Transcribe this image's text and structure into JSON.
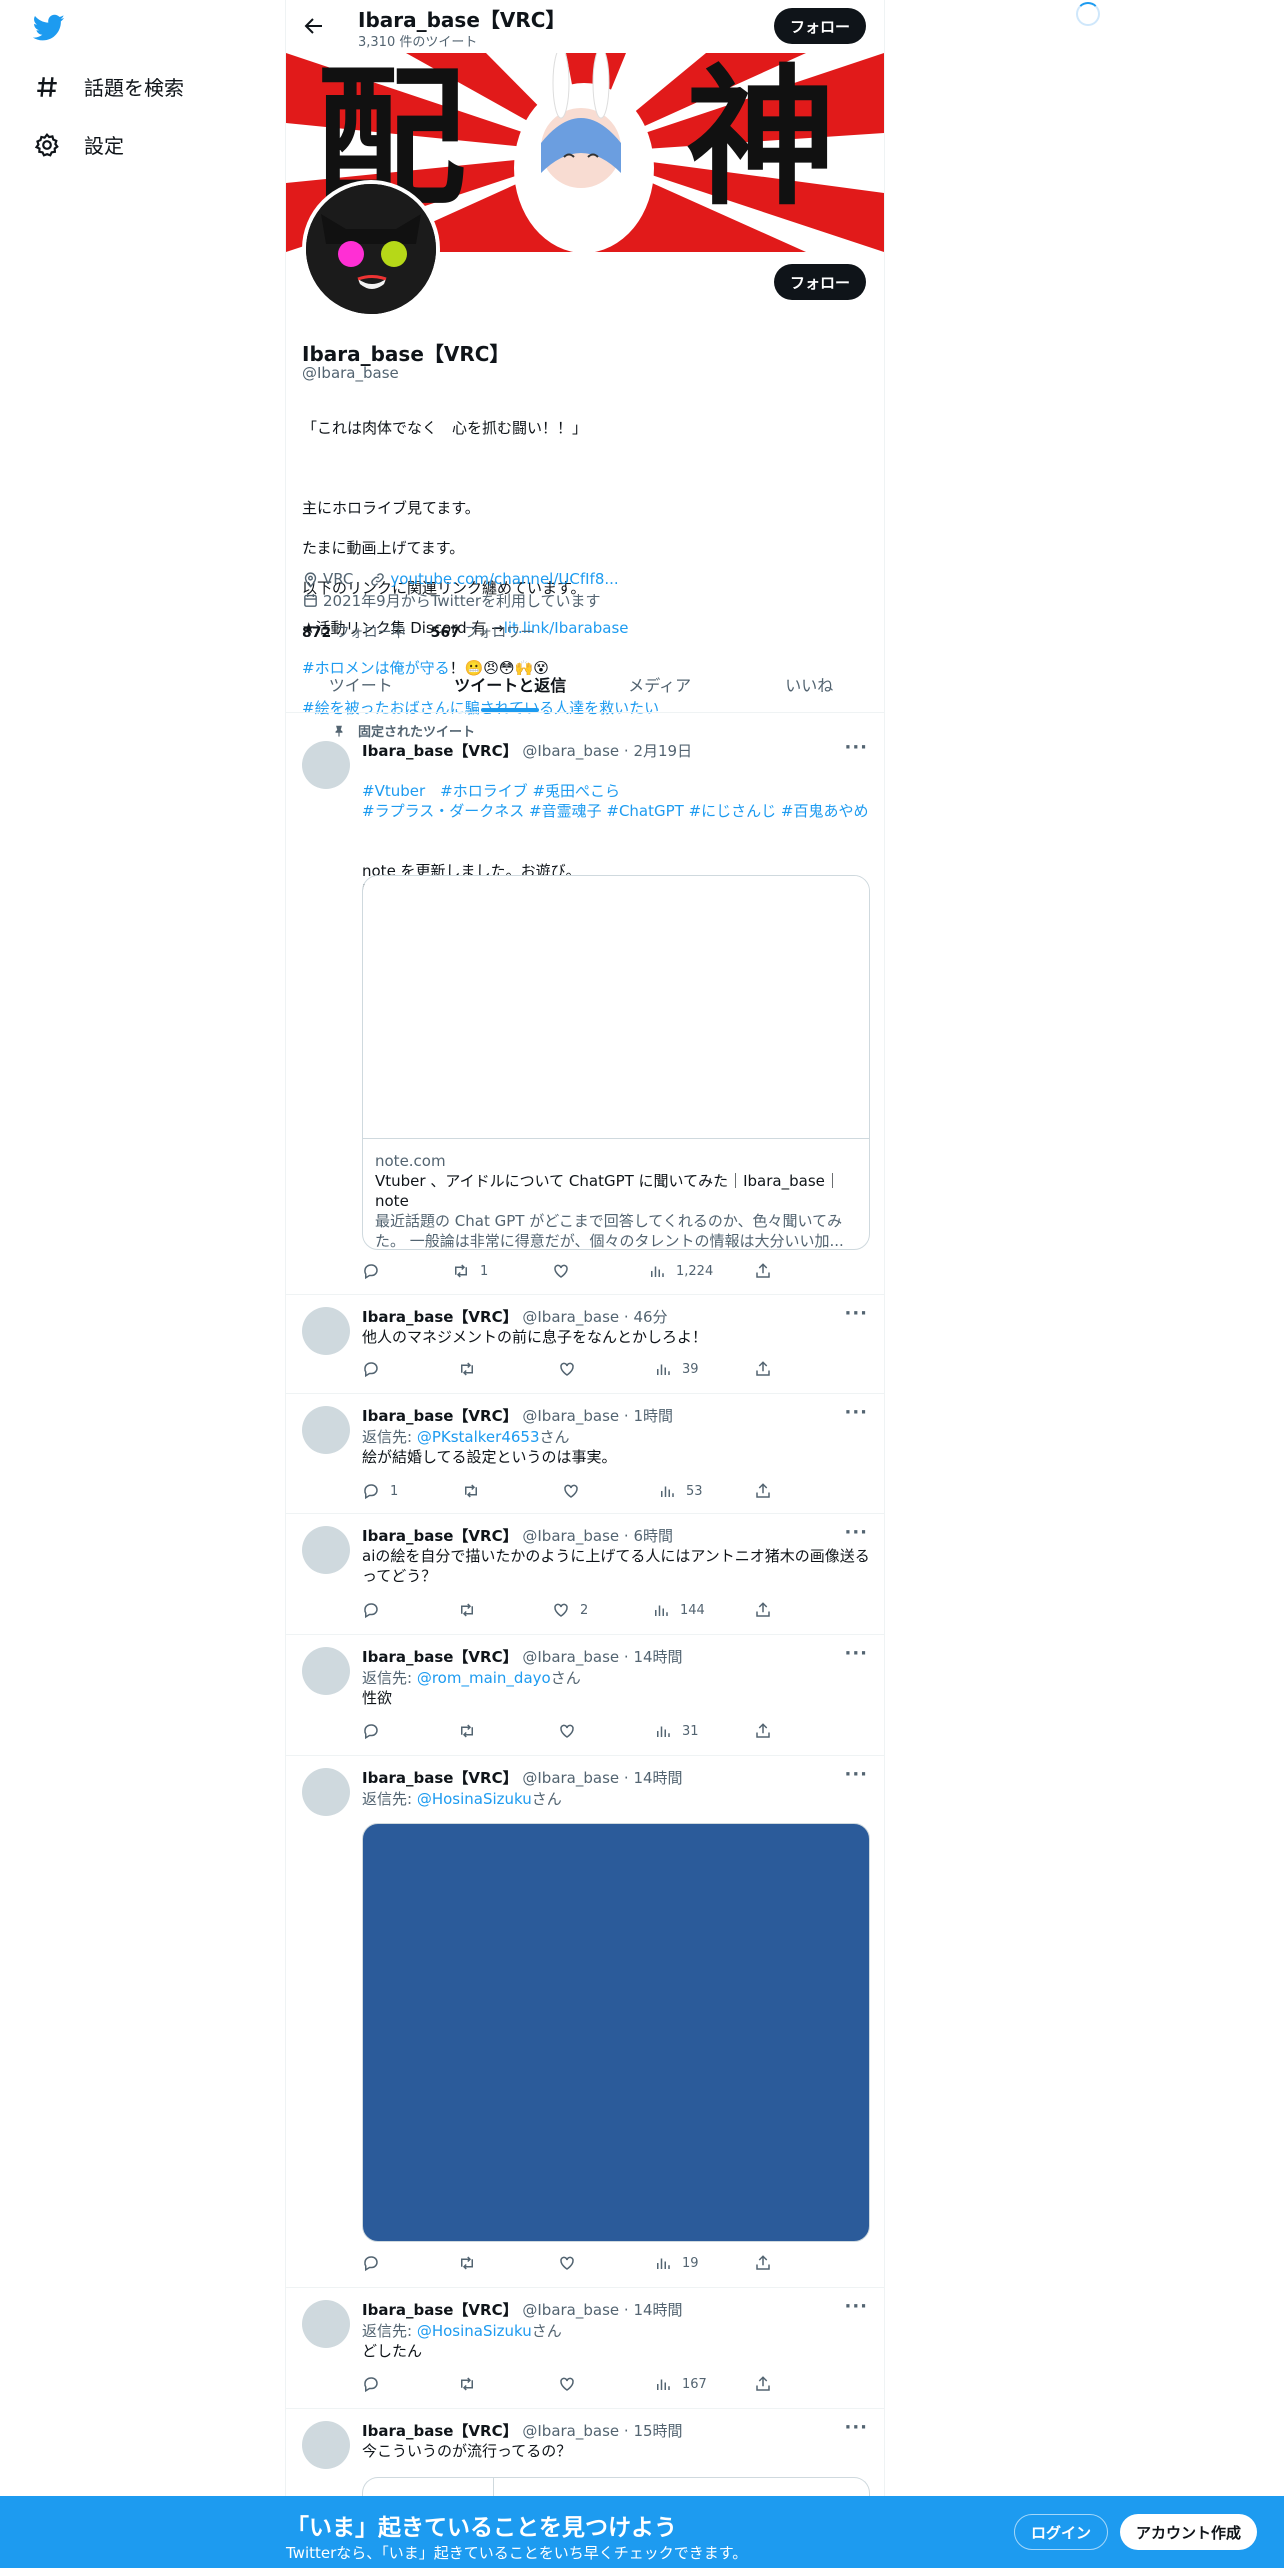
{
  "nav": {
    "explore_label": "話題を検索",
    "settings_label": "設定"
  },
  "header": {
    "name": "Ibara_base【VRC】",
    "tweet_count": "3,310 件のツイート",
    "follow_label": "フォロー"
  },
  "profile": {
    "name": "Ibara_base【VRC】",
    "handle": "@Ibara_base",
    "follow_label": "フォロー",
    "bio_quote": "「これは肉体でなく　心を抓む闘い！！」",
    "bio_line1": "主にホロライブ見てます。",
    "bio_line2": "たまに動画上げてます。",
    "bio_line3": "以下のリンクに関連リンク纏めています。",
    "bio_line4_prefix": "★活動リンク集 Discord 有 →",
    "bio_link": "lit.link/Ibarabase",
    "bio_hashtag1": "#ホロメンは俺が守る",
    "bio_hashtag1_suffix": "！😬😠😳🙌😵",
    "bio_hashtag2": "#絵を被ったおばさんに騙されている人達を救いたい",
    "location": "VRC",
    "url": "youtube.com/channel/UCfIf8...",
    "joined": "2021年9月からTwitterを利用しています",
    "following_count": "872",
    "following_label": "フォロー中",
    "followers_count": "567",
    "followers_label": "フォロワー",
    "banner_kanji_left": "配",
    "banner_kanji_right": "神"
  },
  "tabs": [
    "ツイート",
    "ツイートと返信",
    "メディア",
    "いいね"
  ],
  "pinned_label": "固定されたツイート",
  "tweets": [
    {
      "name": "Ibara_base【VRC】",
      "handle": "@Ibara_base",
      "time": "2月19日",
      "hashtags1": "#Vtuber　#ホロライブ #兎田ぺこら",
      "hashtags2": "#ラプラス・ダークネス #音霊魂子 #ChatGPT #にじさんじ #百鬼あやめ",
      "text": "note を更新しました。お遊び。\n回答がまとも過ぎた",
      "card_domain": "note.com",
      "card_title": "Vtuber 、アイドルについて ChatGPT に聞いてみた｜Ibara_base｜note",
      "card_desc": "最近話題の Chat GPT がどこまで回答してくれるのか、色々聞いてみた。 一般論は非常に得意だが、個々のタレントの情報は大分いい加...",
      "replies": "",
      "retweets": "1",
      "likes": "",
      "views": "1,224"
    },
    {
      "name": "Ibara_base【VRC】",
      "handle": "@Ibara_base",
      "time": "46分",
      "text": "他人のマネジメントの前に息子をなんとかしろよ！",
      "replies": "",
      "retweets": "",
      "likes": "",
      "views": "39"
    },
    {
      "name": "Ibara_base【VRC】",
      "handle": "@Ibara_base",
      "time": "1時間",
      "reply_prefix": "返信先: ",
      "reply_to": "@PKstalker4653",
      "reply_suffix": "さん",
      "text": "絵が結婚してる設定というのは事実。",
      "replies": "1",
      "retweets": "",
      "likes": "",
      "views": "53"
    },
    {
      "name": "Ibara_base【VRC】",
      "handle": "@Ibara_base",
      "time": "6時間",
      "text": "aiの絵を自分で描いたかのように上げてる人にはアントニオ猪木の画像送るってどう？",
      "replies": "",
      "retweets": "",
      "likes": "2",
      "views": "144"
    },
    {
      "name": "Ibara_base【VRC】",
      "handle": "@Ibara_base",
      "time": "14時間",
      "reply_prefix": "返信先: ",
      "reply_to": "@rom_main_dayo",
      "reply_suffix": "さん",
      "text": "性欲",
      "replies": "",
      "retweets": "",
      "likes": "",
      "views": "31"
    },
    {
      "name": "Ibara_base【VRC】",
      "handle": "@Ibara_base",
      "time": "14時間",
      "reply_prefix": "返信先: ",
      "reply_to": "@HosinaSizuku",
      "reply_suffix": "さん",
      "replies": "",
      "retweets": "",
      "likes": "",
      "views": "19"
    },
    {
      "name": "Ibara_base【VRC】",
      "handle": "@Ibara_base",
      "time": "14時間",
      "reply_prefix": "返信先: ",
      "reply_to": "@HosinaSizuku",
      "reply_suffix": "さん",
      "text": "どしたん",
      "replies": "",
      "retweets": "",
      "likes": "",
      "views": "167"
    },
    {
      "name": "Ibara_base【VRC】",
      "handle": "@Ibara_base",
      "time": "15時間",
      "text": "今こういうのが流行ってるの？"
    }
  ],
  "bottom_bar": {
    "title": "「いま」起きていることを見つけよう",
    "subtitle": "Twitterなら、「いま」起きていることをいち早くチェックできます。",
    "login_label": "ログイン",
    "signup_label": "アカウント作成"
  },
  "colors": {
    "accent": "#1d9bf0",
    "banner": "#e11a1a",
    "media": "#2b5b9a"
  }
}
